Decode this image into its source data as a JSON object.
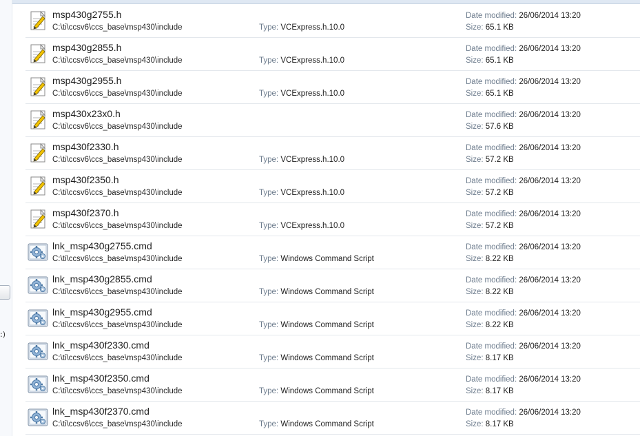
{
  "labels": {
    "type": "Type:",
    "date_modified": "Date modified:",
    "size": "Size:"
  },
  "left_pane": {
    "stub_text": ":)"
  },
  "files": [
    {
      "name": "msp430g2755.h",
      "path": "C:\\ti\\ccsv6\\ccs_base\\msp430\\include",
      "type": "VCExpress.h.10.0",
      "date": "26/06/2014 13:20",
      "size": "65.1 KB",
      "icon": "header-file-icon"
    },
    {
      "name": "msp430g2855.h",
      "path": "C:\\ti\\ccsv6\\ccs_base\\msp430\\include",
      "type": "VCExpress.h.10.0",
      "date": "26/06/2014 13:20",
      "size": "65.1 KB",
      "icon": "header-file-icon"
    },
    {
      "name": "msp430g2955.h",
      "path": "C:\\ti\\ccsv6\\ccs_base\\msp430\\include",
      "type": "VCExpress.h.10.0",
      "date": "26/06/2014 13:20",
      "size": "65.1 KB",
      "icon": "header-file-icon"
    },
    {
      "name": "msp430x23x0.h",
      "path": "C:\\ti\\ccsv6\\ccs_base\\msp430\\include",
      "type": "",
      "date": "26/06/2014 13:20",
      "size": "57.6 KB",
      "icon": "header-file-icon"
    },
    {
      "name": "msp430f2330.h",
      "path": "C:\\ti\\ccsv6\\ccs_base\\msp430\\include",
      "type": "VCExpress.h.10.0",
      "date": "26/06/2014 13:20",
      "size": "57.2 KB",
      "icon": "header-file-icon"
    },
    {
      "name": "msp430f2350.h",
      "path": "C:\\ti\\ccsv6\\ccs_base\\msp430\\include",
      "type": "VCExpress.h.10.0",
      "date": "26/06/2014 13:20",
      "size": "57.2 KB",
      "icon": "header-file-icon"
    },
    {
      "name": "msp430f2370.h",
      "path": "C:\\ti\\ccsv6\\ccs_base\\msp430\\include",
      "type": "VCExpress.h.10.0",
      "date": "26/06/2014 13:20",
      "size": "57.2 KB",
      "icon": "header-file-icon"
    },
    {
      "name": "lnk_msp430g2755.cmd",
      "path": "C:\\ti\\ccsv6\\ccs_base\\msp430\\include",
      "type": "Windows Command Script",
      "date": "26/06/2014 13:20",
      "size": "8.22 KB",
      "icon": "command-script-icon"
    },
    {
      "name": "lnk_msp430g2855.cmd",
      "path": "C:\\ti\\ccsv6\\ccs_base\\msp430\\include",
      "type": "Windows Command Script",
      "date": "26/06/2014 13:20",
      "size": "8.22 KB",
      "icon": "command-script-icon"
    },
    {
      "name": "lnk_msp430g2955.cmd",
      "path": "C:\\ti\\ccsv6\\ccs_base\\msp430\\include",
      "type": "Windows Command Script",
      "date": "26/06/2014 13:20",
      "size": "8.22 KB",
      "icon": "command-script-icon"
    },
    {
      "name": "lnk_msp430f2330.cmd",
      "path": "C:\\ti\\ccsv6\\ccs_base\\msp430\\include",
      "type": "Windows Command Script",
      "date": "26/06/2014 13:20",
      "size": "8.17 KB",
      "icon": "command-script-icon"
    },
    {
      "name": "lnk_msp430f2350.cmd",
      "path": "C:\\ti\\ccsv6\\ccs_base\\msp430\\include",
      "type": "Windows Command Script",
      "date": "26/06/2014 13:20",
      "size": "8.17 KB",
      "icon": "command-script-icon"
    },
    {
      "name": "lnk_msp430f2370.cmd",
      "path": "C:\\ti\\ccsv6\\ccs_base\\msp430\\include",
      "type": "Windows Command Script",
      "date": "26/06/2014 13:20",
      "size": "8.17 KB",
      "icon": "command-script-icon"
    }
  ]
}
